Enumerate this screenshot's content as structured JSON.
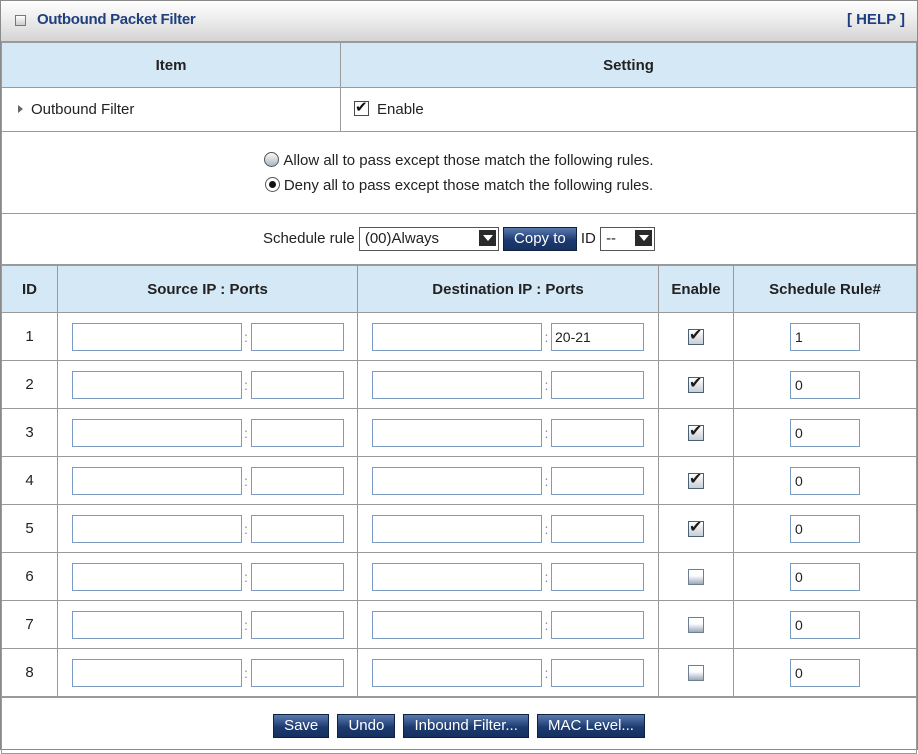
{
  "panel": {
    "title": "Outbound Packet Filter",
    "help": "[ HELP ]"
  },
  "header": {
    "item": "Item",
    "setting": "Setting"
  },
  "filter": {
    "label": "Outbound Filter",
    "enable_label": "Enable",
    "enabled": true
  },
  "policy": {
    "allow_label": "Allow all to pass except those match the following rules.",
    "deny_label": "Deny all to pass except those match the following rules.",
    "selected": "deny"
  },
  "schedule": {
    "label": "Schedule rule",
    "selected": "(00)Always",
    "copy_button": "Copy to",
    "id_label": "ID",
    "id_selected": "--"
  },
  "columns": [
    "ID",
    "Source IP : Ports",
    "Destination IP : Ports",
    "Enable",
    "Schedule Rule#"
  ],
  "rules": [
    {
      "id": "1",
      "src_ip": "",
      "src_port": "",
      "dst_ip": "",
      "dst_port": "20-21",
      "enabled": true,
      "schedule": "1"
    },
    {
      "id": "2",
      "src_ip": "",
      "src_port": "",
      "dst_ip": "",
      "dst_port": "",
      "enabled": true,
      "schedule": "0"
    },
    {
      "id": "3",
      "src_ip": "",
      "src_port": "",
      "dst_ip": "",
      "dst_port": "",
      "enabled": true,
      "schedule": "0"
    },
    {
      "id": "4",
      "src_ip": "",
      "src_port": "",
      "dst_ip": "",
      "dst_port": "",
      "enabled": true,
      "schedule": "0"
    },
    {
      "id": "5",
      "src_ip": "",
      "src_port": "",
      "dst_ip": "",
      "dst_port": "",
      "enabled": true,
      "schedule": "0"
    },
    {
      "id": "6",
      "src_ip": "",
      "src_port": "",
      "dst_ip": "",
      "dst_port": "",
      "enabled": false,
      "schedule": "0"
    },
    {
      "id": "7",
      "src_ip": "",
      "src_port": "",
      "dst_ip": "",
      "dst_port": "",
      "enabled": false,
      "schedule": "0"
    },
    {
      "id": "8",
      "src_ip": "",
      "src_port": "",
      "dst_ip": "",
      "dst_port": "",
      "enabled": false,
      "schedule": "0"
    }
  ],
  "buttons": {
    "save": "Save",
    "undo": "Undo",
    "inbound": "Inbound Filter...",
    "mac": "MAC Level..."
  },
  "icons": {
    "panel_bullet": "square-bullet-icon",
    "row_arrow": "triangle-right-icon",
    "dropdown": "chevron-down-icon"
  },
  "colors": {
    "header_bg": "#d5e8f5",
    "title_text": "#1f3f7f",
    "button_bg": "#1d3b70",
    "input_border": "#7a9cc0"
  }
}
